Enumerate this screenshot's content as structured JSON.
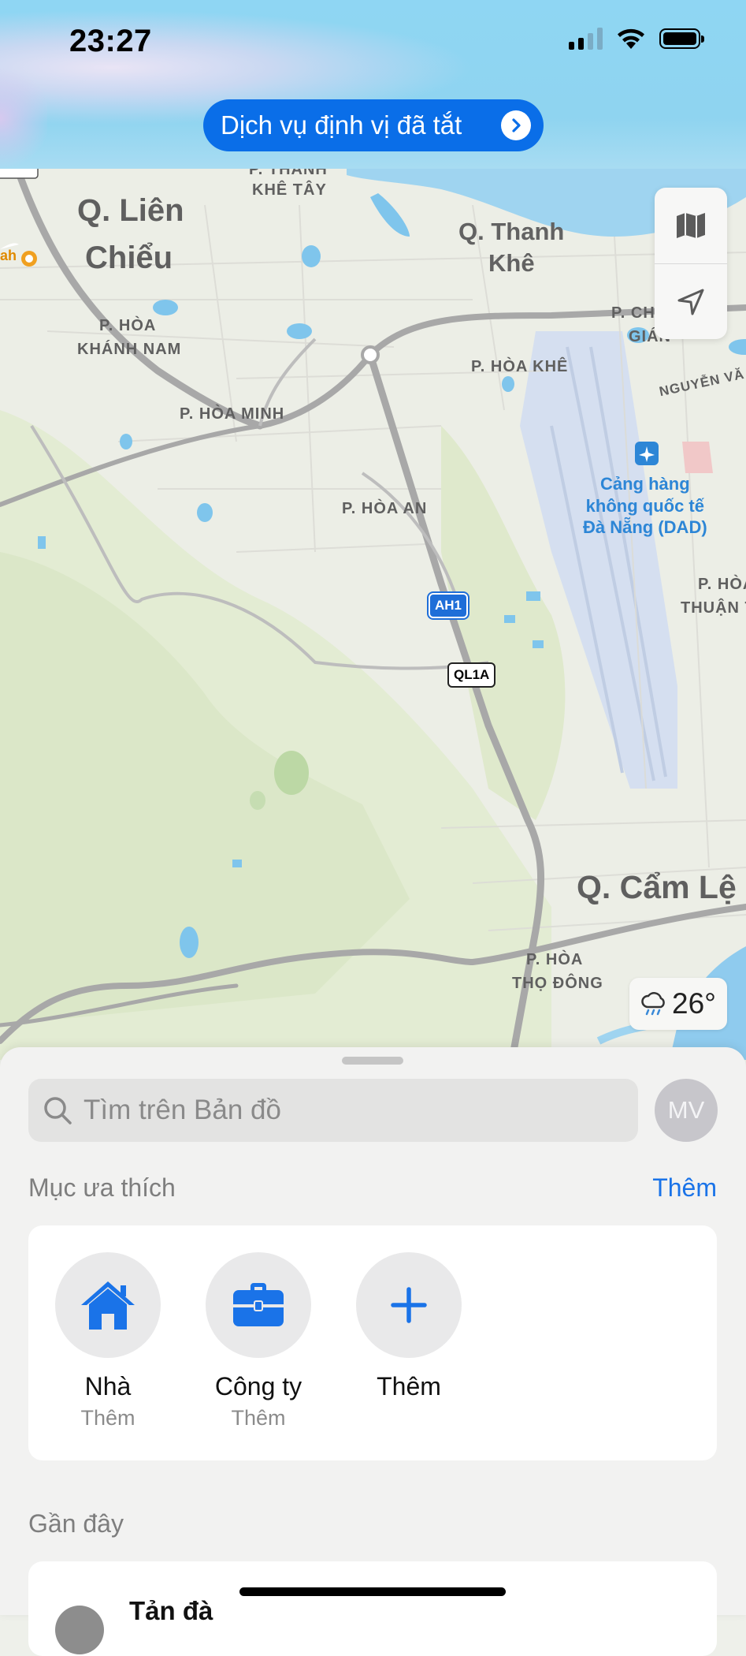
{
  "status_bar": {
    "time": "23:27"
  },
  "location_banner": {
    "label": "Dịch vụ định vị đã tắt"
  },
  "map": {
    "districts": [
      "Q. Liên",
      "Chiểu",
      "Q. Thanh",
      "Khê",
      "Q. Cẩm Lệ"
    ],
    "wards": {
      "thanh_khe_tay_top": "P. THANH",
      "thanh_khe_tay": "KHÊ TÂY",
      "hoa_khanh_nam_1": "P. HÒA",
      "hoa_khanh_nam_2": "KHÁNH NAM",
      "hoa_minh": "P. HÒA MINH",
      "hoa_khe": "P. HÒA KHÊ",
      "hoa_an": "P. HÒA AN",
      "chinh_gian_1": "P. CH",
      "chinh_gian_2": "GIÁN",
      "hoa_thuan_1": "P. HÒA",
      "hoa_thuan_2": "THUẬN T",
      "hoa_tho_dong_1": "P. HÒA",
      "hoa_tho_dong_2": "THỌ ĐÔNG",
      "street_nguyen": "NGUYỄN VĂ"
    },
    "airport": {
      "line1": "Cảng hàng",
      "line2": "không quốc tế",
      "line3": "Đà Nẵng (DAD)"
    },
    "shields": {
      "ah1": "AH1",
      "ql1a": "QL1A"
    },
    "poi_edge": "ah",
    "weather": {
      "temp": "26°",
      "icon": "cloud-rain-icon"
    }
  },
  "sheet": {
    "search_placeholder": "Tìm trên Bản đồ",
    "avatar_initials": "MV",
    "favorites": {
      "title": "Mục ưa thích",
      "action": "Thêm",
      "items": [
        {
          "name": "Nhà",
          "sub": "Thêm",
          "icon": "house-icon"
        },
        {
          "name": "Công ty",
          "sub": "Thêm",
          "icon": "briefcase-icon"
        },
        {
          "name": "Thêm",
          "icon": "plus-icon"
        }
      ]
    },
    "recent": {
      "title": "Gần đây",
      "items": [
        {
          "title": "Tản đà"
        }
      ]
    }
  },
  "colors": {
    "accent": "#1a73e8",
    "banner": "#0a6ee8"
  }
}
